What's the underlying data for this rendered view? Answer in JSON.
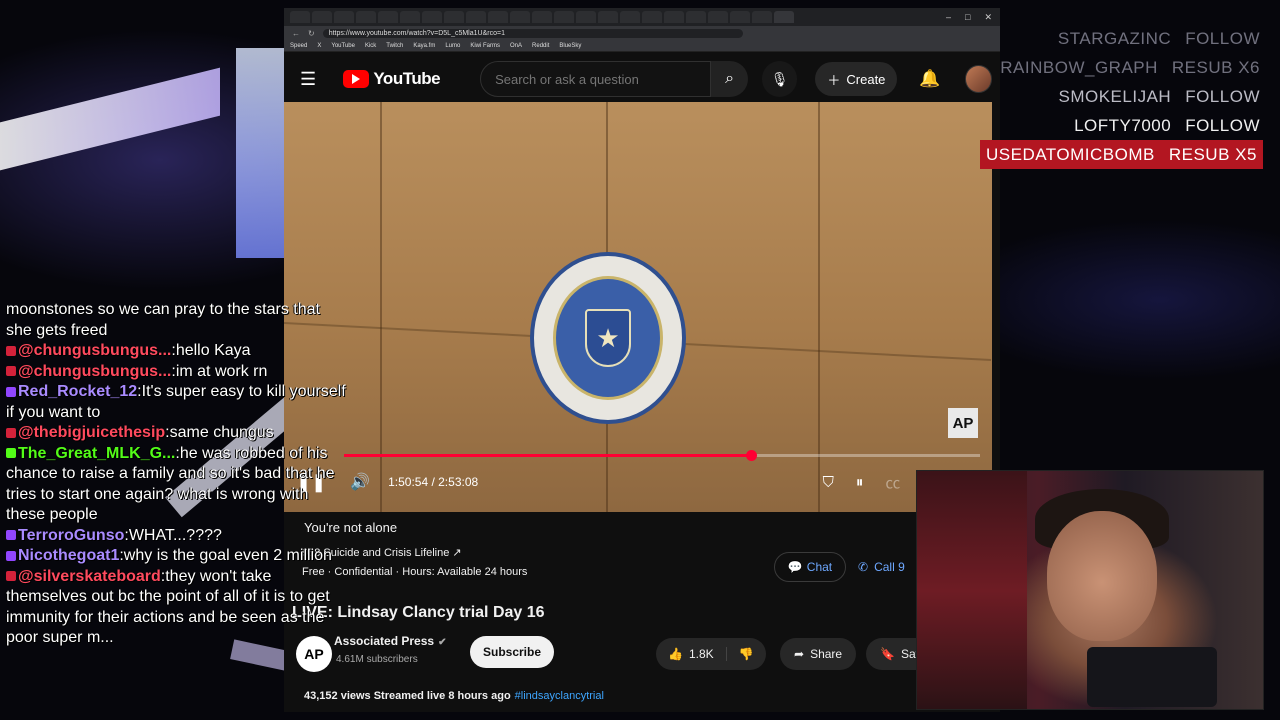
{
  "browser": {
    "url": "https://www.youtube.com/watch?v=D5L_c5Mla1U&rco=1",
    "bookmarks": [
      "Speed",
      "X",
      "YouTube",
      "Kick",
      "Twitch",
      "Kaya.fm",
      "Lumo",
      "Kiwi Farms",
      "OnA",
      "Reddit",
      "BlueSky"
    ]
  },
  "youtube": {
    "logo_text": "YouTube",
    "search_placeholder": "Search or ask a question",
    "create_label": "Create"
  },
  "player": {
    "time_text": "1:50:54 / 2:53:08",
    "progress": 0.64,
    "ap_logo": "AP"
  },
  "crisis": {
    "title": "You're not alone",
    "lifeline": "988 Suicide and Crisis Lifeline ↗",
    "details": "Free · Confidential · Hours: Available 24 hours",
    "chat_label": "Chat",
    "call_label": "Call 9"
  },
  "video": {
    "title": "LIVE: Lindsay Clancy trial Day 16",
    "channel": "Associated Press",
    "subscribers": "4.61M subscribers",
    "subscribe_label": "Subscribe",
    "likes": "1.8K",
    "share_label": "Share",
    "save_label": "Save",
    "meta": "43,152 views  Streamed live 8 hours ago",
    "hashtag": "#lindsayclancytrial"
  },
  "alerts": [
    {
      "name": "STARGAZINC",
      "action": "FOLLOW",
      "style": "dim"
    },
    {
      "name": "RAINBOW_GRAPH",
      "action": "RESUB X6",
      "style": "dim"
    },
    {
      "name": "SMOKELIJAH",
      "action": "FOLLOW",
      "style": "mid"
    },
    {
      "name": "LOFTY7000",
      "action": "FOLLOW",
      "style": "bright"
    },
    {
      "name": "USEDATOMICBOMB",
      "action": "RESUB X5",
      "style": "hl"
    }
  ],
  "chat": [
    {
      "platform": "",
      "user": "",
      "text": "moonstones so we can pray to the stars that she gets freed"
    },
    {
      "platform": "youtube",
      "user": "@chungusbungus...",
      "text": ":hello Kaya"
    },
    {
      "platform": "youtube",
      "user": "@chungusbungus...",
      "text": ":im at work rn"
    },
    {
      "platform": "twitch",
      "user": "Red_Rocket_12",
      "text": ":It's super easy to kill yourself if you want to"
    },
    {
      "platform": "youtube",
      "user": "@thebigjuicethesip",
      "text": ":same chungus"
    },
    {
      "platform": "kick",
      "user": "The_Great_MLK_G...",
      "text": ":he was robbed of his chance to raise a family and so it's bad that he tries to start one again? what is wrong with these people"
    },
    {
      "platform": "twitch",
      "user": "TerroroGunso",
      "text": ":WHAT...????"
    },
    {
      "platform": "twitch",
      "user": "Nicothegoat1",
      "text": ":why is the goal even 2 million"
    },
    {
      "platform": "youtube",
      "user": "@silverskateboard",
      "text": ":they won't take themselves out bc the point of all of it is to get immunity for their actions and be seen as the poor super m..."
    }
  ]
}
